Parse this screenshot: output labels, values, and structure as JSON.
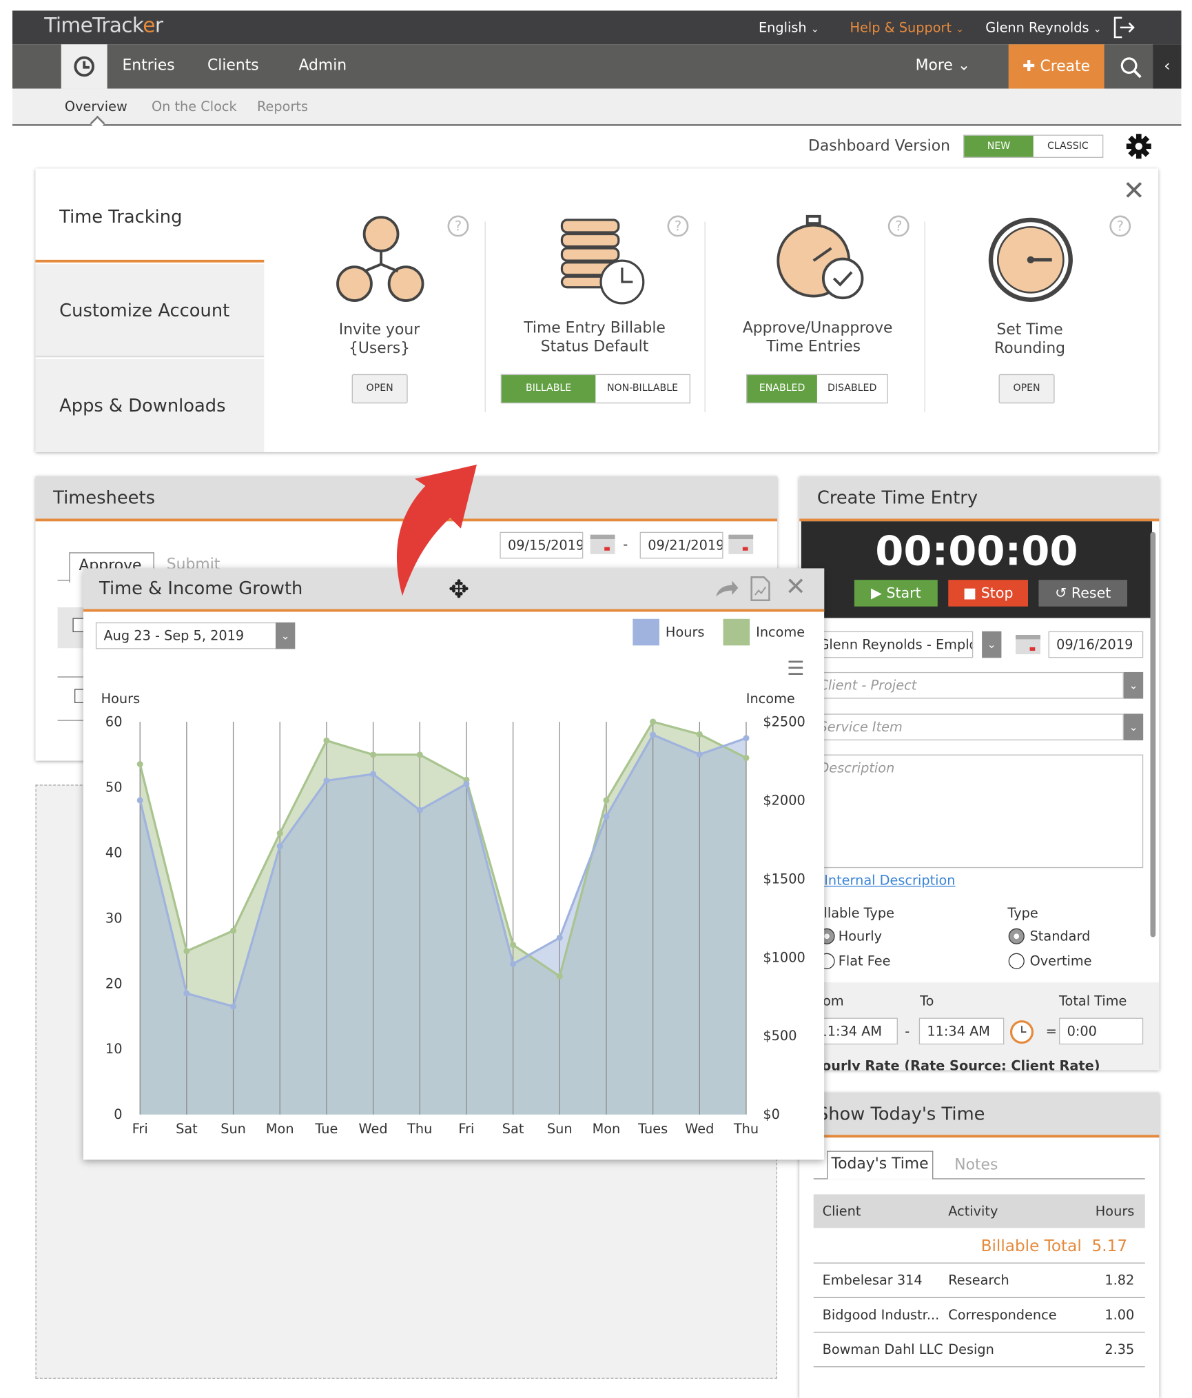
{
  "app": {
    "logo": "TimeTracker",
    "language": "English",
    "help": "Help & Support",
    "user": "Glenn Reynolds"
  },
  "nav": {
    "items": [
      "Entries",
      "Clients",
      "Admin"
    ],
    "more": "More",
    "create": "Create"
  },
  "subnav": {
    "items": [
      "Overview",
      "On the Clock",
      "Reports"
    ],
    "active": "Overview"
  },
  "dashboard": {
    "label": "Dashboard Version",
    "new": "NEW",
    "classic": "CLASSIC"
  },
  "colors": {
    "accent": "#e58a3c",
    "green": "#62a043",
    "red": "#e24a2c",
    "topbar": "#3f3f41",
    "hours": "#9fb3de",
    "income": "#a9c48f"
  },
  "setup": {
    "tabs": [
      "Time Tracking",
      "Customize Account",
      "Apps & Downloads"
    ],
    "features": [
      {
        "title1": "Invite your",
        "title2": "{Users}",
        "icon": "users-network-icon",
        "button": "OPEN"
      },
      {
        "title1": "Time Entry Billable",
        "title2": "Status Default",
        "icon": "coins-clock-icon",
        "options": [
          "BILLABLE",
          "NON-BILLABLE"
        ],
        "selected": "BILLABLE"
      },
      {
        "title1": "Approve/Unapprove",
        "title2": "Time Entries",
        "icon": "stopwatch-check-icon",
        "options": [
          "ENABLED",
          "DISABLED"
        ],
        "selected": "ENABLED"
      },
      {
        "title1": "Set Time",
        "title2": "Rounding",
        "icon": "clock-icon",
        "button": "OPEN"
      }
    ]
  },
  "timesheets": {
    "title": "Timesheets",
    "start": "09/15/2019",
    "end": "09/21/2019",
    "sep": "-",
    "tabs": [
      "Approve",
      "Submit"
    ]
  },
  "popup": {
    "title": "Time & Income Growth",
    "range": "Aug 23 - Sep 5, 2019"
  },
  "chart_data": {
    "type": "area",
    "categories": [
      "Fri",
      "Sat",
      "Sun",
      "Mon",
      "Tue",
      "Wed",
      "Thu",
      "Fri",
      "Sat",
      "Sun",
      "Mon",
      "Tues",
      "Wed",
      "Thu"
    ],
    "ylabel": "Hours",
    "y2label": "Income",
    "ylim": [
      0,
      60
    ],
    "y2lim": [
      0,
      2500
    ],
    "yticks": [
      "0",
      "10",
      "20",
      "30",
      "40",
      "50",
      "60"
    ],
    "y2ticks": [
      "$0",
      "$500",
      "$1000",
      "$1500",
      "$2000",
      "$2500"
    ],
    "grid": "vertical",
    "legend": "top-right",
    "series": [
      {
        "name": "Hours",
        "axis": "left",
        "values": [
          48,
          18.5,
          16.5,
          41,
          51,
          52,
          46.5,
          50.5,
          23,
          27,
          45.5,
          58,
          55,
          57.5
        ]
      },
      {
        "name": "Income",
        "axis": "right",
        "values": [
          2230,
          1040,
          1170,
          1790,
          2380,
          2290,
          2290,
          2130,
          1080,
          880,
          2000,
          2500,
          2420,
          2270
        ]
      }
    ]
  },
  "entry": {
    "title": "Create Time Entry",
    "timer": "00:00:00",
    "start": "Start",
    "stop": "Stop",
    "reset": "Reset",
    "employee": "Glenn Reynolds - Emplo...",
    "date": "09/16/2019",
    "client_ph": "Client - Project",
    "service_ph": "Service Item",
    "desc_ph": "Description",
    "internal": "Internal Description",
    "billable_type": "Billable Type",
    "hourly": "Hourly",
    "flat": "Flat Fee",
    "type": "Type",
    "standard": "Standard",
    "overtime": "Overtime",
    "from": "From",
    "to": "To",
    "total": "Total Time",
    "from_val": "11:34 AM",
    "to_val": "11:34 AM",
    "total_val": "0:00",
    "dash": "-",
    "eq": "=",
    "rate": "Hourly Rate (Rate Source: Client Rate)"
  },
  "today": {
    "title": "Show Today's Time",
    "tabs": [
      "Today's Time",
      "Notes"
    ],
    "cols": [
      "Client",
      "Activity",
      "Hours"
    ],
    "billable_label": "Billable Total",
    "billable_total": "5.17",
    "rows": [
      {
        "client": "Embelesar 314",
        "activity": "Research",
        "hours": "1.82"
      },
      {
        "client": "Bidgood Industr...",
        "activity": "Correspondence",
        "hours": "1.00"
      },
      {
        "client": "Bowman Dahl LLC",
        "activity": "Design",
        "hours": "2.35"
      }
    ]
  }
}
